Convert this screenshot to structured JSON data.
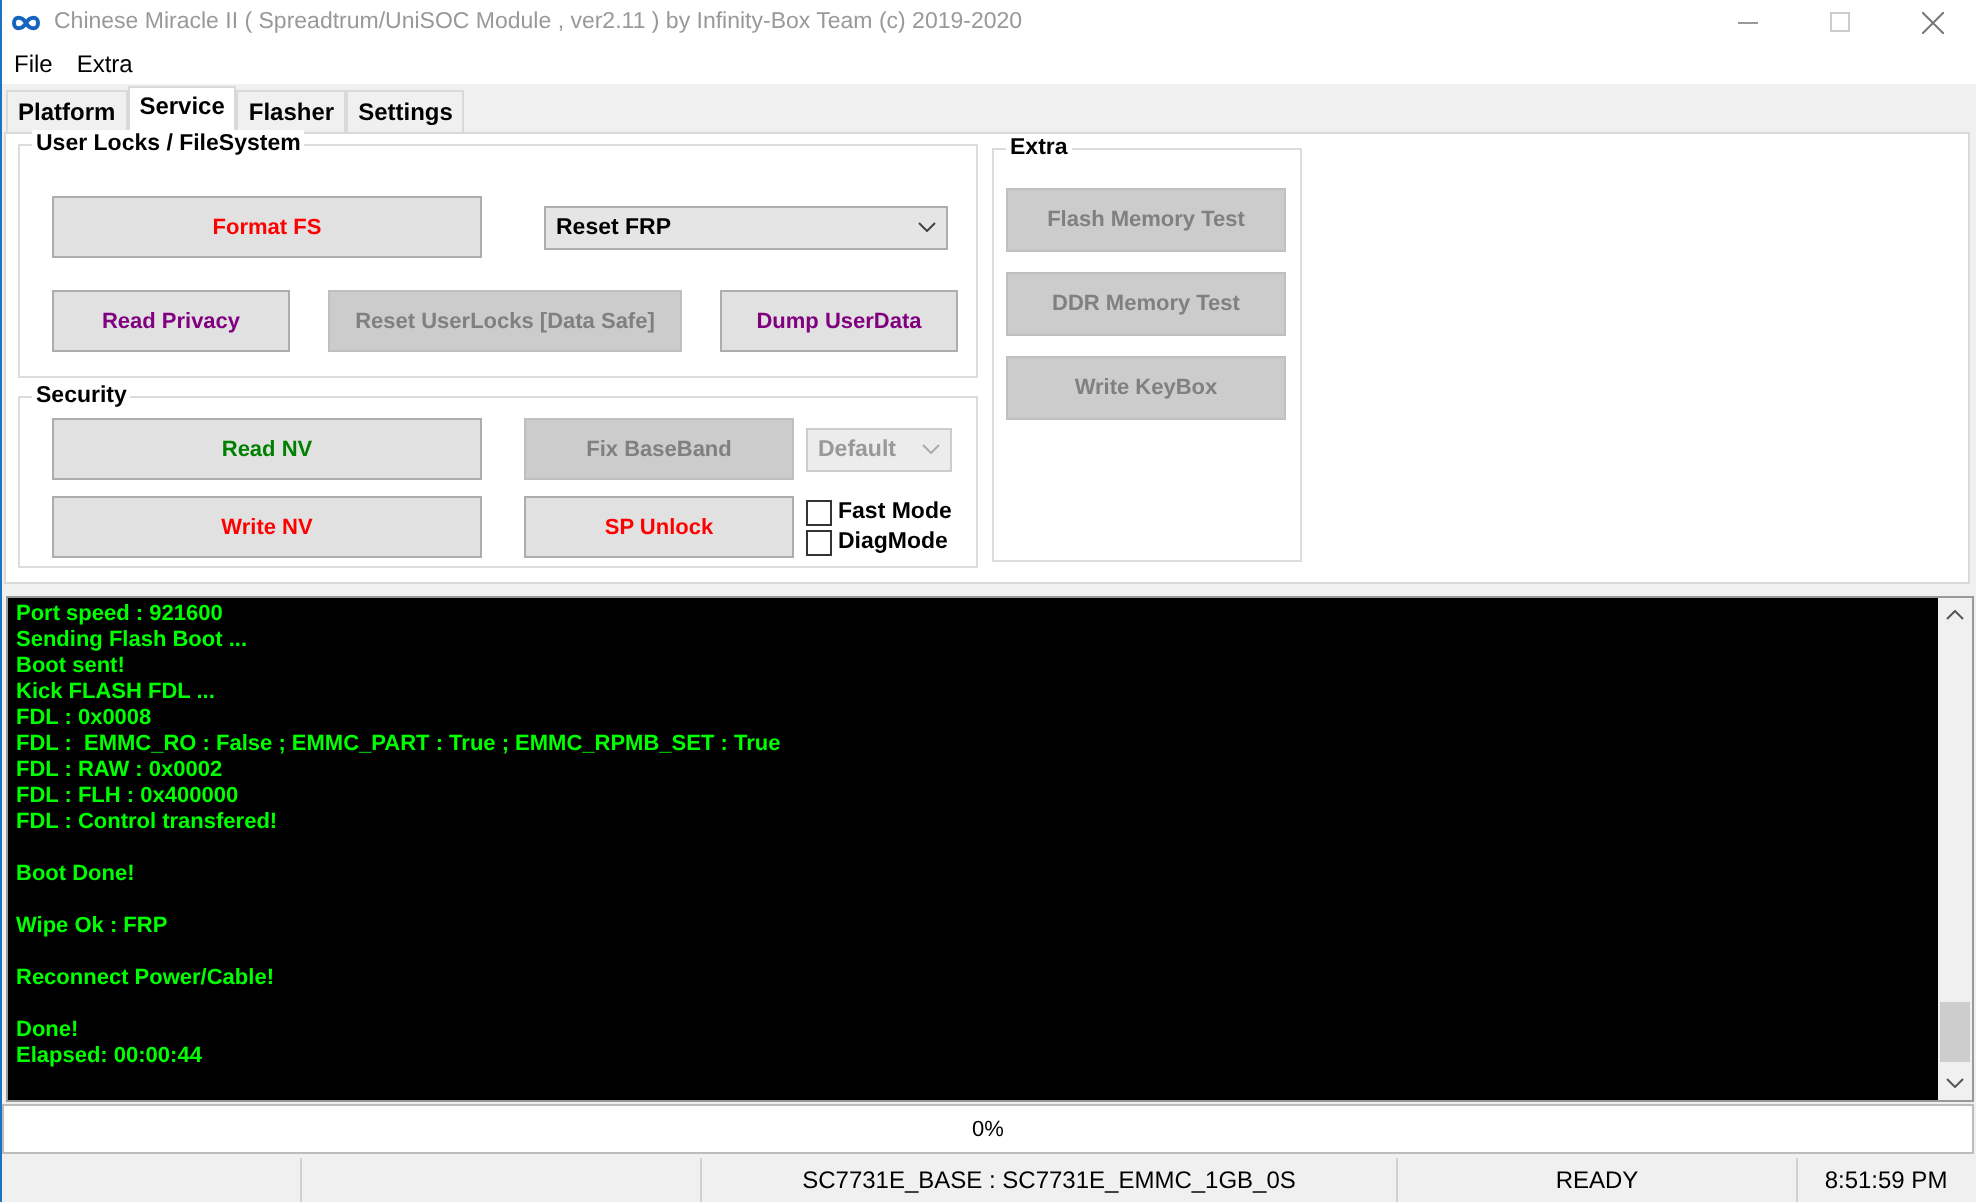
{
  "window": {
    "title": "Chinese Miracle II ( Spreadtrum/UniSOC Module , ver2.11  ) by Infinity-Box Team (c) 2019-2020"
  },
  "menu": [
    "File",
    "Extra"
  ],
  "tabs": [
    {
      "label": "Platform",
      "selected": false
    },
    {
      "label": "Service",
      "selected": true
    },
    {
      "label": "Flasher",
      "selected": false
    },
    {
      "label": "Settings",
      "selected": false
    }
  ],
  "user_locks": {
    "title": "User Locks  / FileSystem",
    "format_button": {
      "label": "Format FS",
      "color": "#ff0000",
      "disabled": false
    },
    "mode_dropdown": {
      "value": "Reset FRP",
      "disabled": false
    },
    "buttons": [
      {
        "label": "Read Privacy",
        "color": "#800080",
        "disabled": false
      },
      {
        "label": "Reset UserLocks [Data Safe]",
        "color": "#808080",
        "disabled": true
      },
      {
        "label": "Dump UserData",
        "color": "#800080",
        "disabled": false
      }
    ]
  },
  "security": {
    "title": "Security",
    "read_nv": {
      "label": "Read NV",
      "color": "#008000",
      "disabled": false
    },
    "fix_baseband": {
      "label": "Fix BaseBand",
      "color": "#808080",
      "disabled": true
    },
    "baseband_dropdown": {
      "value": "Default",
      "disabled": true
    },
    "write_nv": {
      "label": "Write NV",
      "color": "#ff0000",
      "disabled": false
    },
    "sp_unlock": {
      "label": "SP Unlock",
      "color": "#ff0000",
      "disabled": false
    },
    "checkboxes": [
      {
        "label": "Fast Mode",
        "checked": false
      },
      {
        "label": "DiagMode",
        "checked": false
      }
    ]
  },
  "extra": {
    "title": "Extra",
    "buttons": [
      {
        "label": "Flash Memory Test",
        "color": "#808080",
        "disabled": true
      },
      {
        "label": "DDR Memory Test",
        "color": "#808080",
        "disabled": true
      },
      {
        "label": "Write KeyBox",
        "color": "#808080",
        "disabled": true
      }
    ]
  },
  "log_paragraphs": [
    [
      "Port speed : 921600",
      "Sending Flash Boot ...",
      "Boot sent!",
      "Kick FLASH FDL ...",
      "FDL : 0x0008",
      "FDL :  EMMC_RO : False ; EMMC_PART : True ; EMMC_RPMB_SET : True",
      "FDL : RAW : 0x0002",
      "FDL : FLH : 0x400000",
      "FDL : Control transfered!"
    ],
    [
      "Boot Done!"
    ],
    [
      "Wipe Ok : FRP"
    ],
    [
      "Reconnect Power/Cable!"
    ],
    [
      "Done!",
      "Elapsed: 00:00:44"
    ]
  ],
  "progress": {
    "level": 0,
    "reading": "0%"
  },
  "status_bar": [
    "SC7731E_BASE : SC7731E_EMMC_1GB_0S",
    "READY",
    "8:51:59 PM"
  ]
}
